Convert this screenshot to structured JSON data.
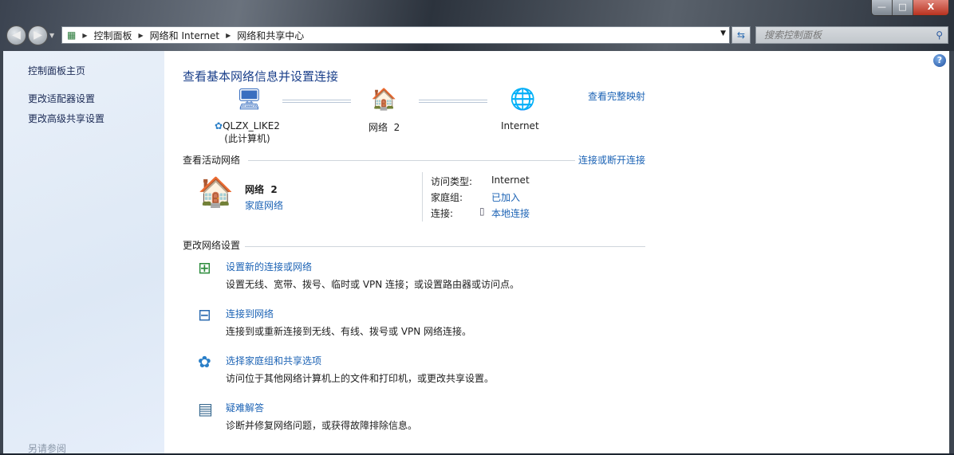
{
  "window": {
    "minimize": "—",
    "maximize": "□",
    "close": "X"
  },
  "address": {
    "crumbs": [
      "控制面板",
      "网络和 Internet",
      "网络和共享中心"
    ],
    "search_placeholder": "搜索控制面板"
  },
  "sidebar": {
    "items": [
      "控制面板主页",
      "更改适配器设置",
      "更改高级共享设置"
    ],
    "see_also": "另请参阅"
  },
  "main": {
    "title": "查看基本网络信息并设置连接",
    "map": {
      "computer": "QLZX_LIKE2",
      "computer_sub": "(此计算机)",
      "network": "网络  2",
      "internet": "Internet",
      "full_map": "查看完整映射"
    },
    "active": {
      "heading": "查看活动网络",
      "connect_link": "连接或断开连接",
      "name": "网络  2",
      "type": "家庭网络",
      "access_label": "访问类型:",
      "access_value": "Internet",
      "homegroup_label": "家庭组:",
      "homegroup_value": "已加入",
      "conn_label": "连接:",
      "conn_value": "本地连接"
    },
    "change": {
      "heading": "更改网络设置",
      "tasks": [
        {
          "link": "设置新的连接或网络",
          "desc": "设置无线、宽带、拨号、临时或 VPN 连接；或设置路由器或访问点。"
        },
        {
          "link": "连接到网络",
          "desc": "连接到或重新连接到无线、有线、拨号或 VPN 网络连接。"
        },
        {
          "link": "选择家庭组和共享选项",
          "desc": "访问位于其他网络计算机上的文件和打印机，或更改共享设置。"
        },
        {
          "link": "疑难解答",
          "desc": "诊断并修复网络问题，或获得故障排除信息。"
        }
      ]
    }
  }
}
